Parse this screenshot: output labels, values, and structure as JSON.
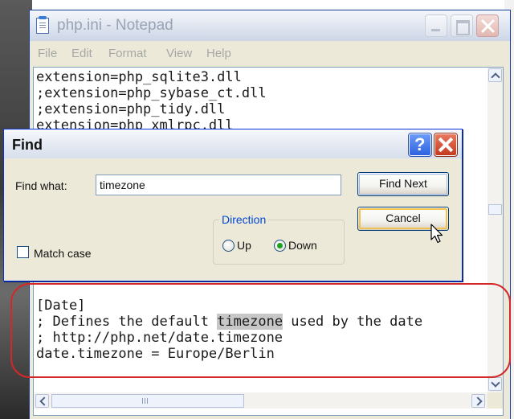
{
  "notepad": {
    "title": "php.ini - Notepad",
    "menu": [
      "File",
      "Edit",
      "Format",
      "View",
      "Help"
    ],
    "lines_top": [
      "extension=php_sqlite3.dll",
      ";extension=php_sybase_ct.dll",
      ";extension=php_tidy.dll",
      "extension=php_xmlrpc.dll"
    ],
    "lines_bottom": {
      "line1": "[Date]",
      "line2_before": "; Defines the default ",
      "line2_match": "timezone",
      "line2_after": " used by the date",
      "line3": "; http://php.net/date.timezone",
      "line4": "date.timezone = Europe/Berlin"
    }
  },
  "find_dialog": {
    "title": "Find",
    "help_symbol": "?",
    "find_what_label": "Find what:",
    "find_what_value": "timezone",
    "find_next_label": "Find Next",
    "cancel_label": "Cancel",
    "direction_label": "Direction",
    "up_label": "Up",
    "down_label": "Down",
    "direction_selected": "Down",
    "match_case_label": "Match case",
    "match_case_checked": false
  },
  "colors": {
    "annotation": "#d42828",
    "radio_selected": "#21a121",
    "direction_label": "#0046d5"
  },
  "icons": [
    "notepad-icon",
    "minimize-icon",
    "maximize-icon",
    "close-icon",
    "help-icon",
    "cursor-icon"
  ]
}
